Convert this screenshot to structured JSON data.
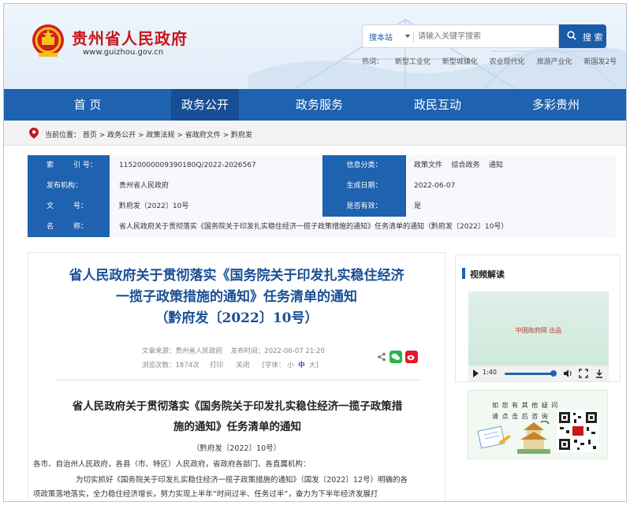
{
  "header": {
    "site_title": "贵州省人民政府",
    "site_url": "www.guizhou.gov.cn",
    "search_scope": "搜本站",
    "search_placeholder": "请输入关键字搜索",
    "search_button": "搜 索",
    "hot_label": "热词：",
    "hot_words": [
      "新型工业化",
      "新型城镇化",
      "农业现代化",
      "旅游产业化",
      "新国发2号"
    ]
  },
  "nav": {
    "items": [
      "首 页",
      "政务公开",
      "政务服务",
      "政民互动",
      "多彩贵州"
    ],
    "active_index": 1
  },
  "breadcrumb": {
    "label": "当前位置：",
    "path": [
      "首页",
      "政务公开",
      "政策法规",
      "省政府文件",
      "黔府发"
    ],
    "separator": " > "
  },
  "info": {
    "index_no_label_a": "索",
    "index_no_label_b": "引  号：",
    "index_no": "11520000009390180Q/2022-2026567",
    "category_label": "信息分类：",
    "category": "政策文件    综合政务    通知",
    "issuer_label": "发布机构：",
    "issuer": "贵州省人民政府",
    "date_label": "生成日期：",
    "date": "2022-06-07",
    "doc_label_a": "文",
    "doc_label_b": "号：",
    "doc_no": "黔府发〔2022〕10号",
    "valid_label": "是否有效：",
    "valid": "是",
    "name_label_a": "名",
    "name_label_b": "称：",
    "name": "省人民政府关于贯彻落实《国务院关于印发扎实稳住经济一揽子政策措施的通知》任务清单的通知（黔府发〔2022〕10号）"
  },
  "article": {
    "title_line1": "省人民政府关于贯彻落实《国务院关于印发扎实稳住经济",
    "title_line2": "一揽子政策措施的通知》任务清单的通知",
    "title_line3": "（黔府发〔2022〕10号）",
    "source": "文章来源：贵州省人民政府    发布时间：2022-06-07 21:20",
    "views": "浏览次数：1874次",
    "print": "打印",
    "close": "关闭",
    "font_label": "[字体：",
    "font_small": "小",
    "font_mid": "中",
    "font_large": "大",
    "font_end": "]",
    "body_title_line1": "省人民政府关于贯彻落实《国务院关于印发扎实稳住经济一揽子政策措",
    "body_title_line2": "施的通知》任务清单的通知",
    "doc_no": "（黔府发〔2022〕10号）",
    "para1": "各市、自治州人民政府，各县（市、特区）人民政府，省政府各部门、各直属机构：",
    "para2": "为切实抓好《国务院关于印发扎实稳住经济一揽子政策措施的通知》（国发〔2022〕12号）明确的各",
    "para3": "项政策落地落实，全力稳住经济增长，努力实现上半年“时间过半、任务过半”，奋力为下半年经济发展打"
  },
  "video": {
    "title": "视频解读",
    "credit": "中国政府网 出品",
    "time": "1:40"
  },
  "qr": {
    "line1": "如 您 有 其 他 疑 问",
    "line2": "请 点 击 后 咨 询"
  },
  "colors": {
    "brand_blue": "#1e62b0",
    "title_red": "#c8161d",
    "title_blue": "#1a4f95"
  }
}
